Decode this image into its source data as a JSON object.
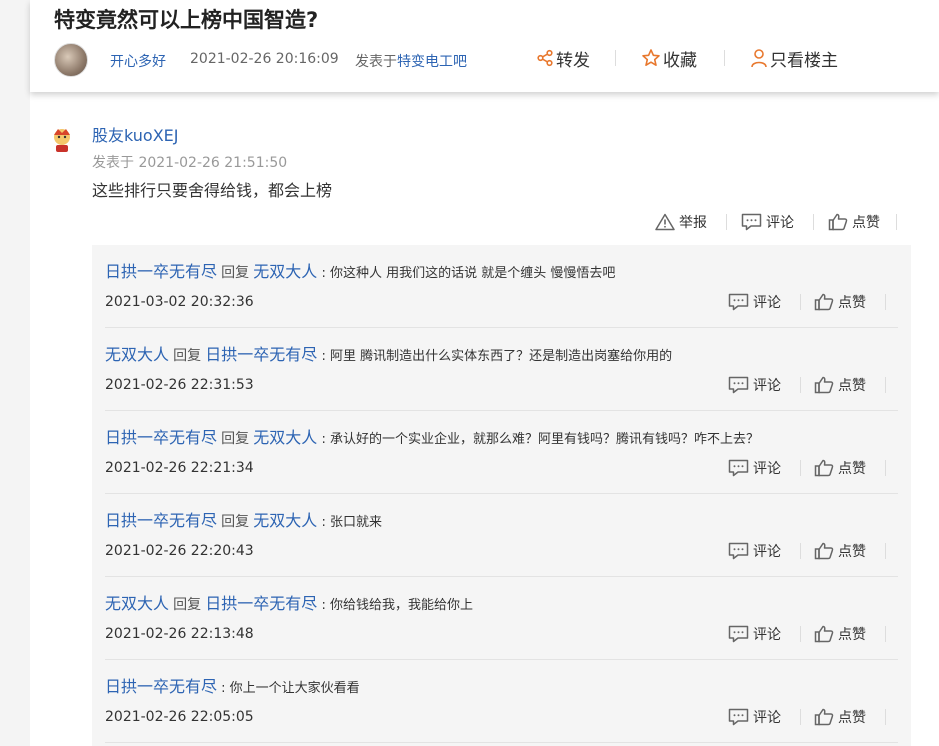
{
  "post": {
    "title": "特变竟然可以上榜中国智造?",
    "author": "开心多好",
    "time": "2021-02-26 20:16:09",
    "posted_in_label": "发表于",
    "forum": "特变电工吧",
    "actions": {
      "share": "转发",
      "favorite": "收藏",
      "only_op": "只看楼主"
    }
  },
  "floor": {
    "author": "股友kuoXEJ",
    "time": "发表于 2021-02-26 21:51:50",
    "text": "这些排行只要舍得给钱，都会上榜",
    "actions": {
      "report": "举报",
      "comment": "评论",
      "like": "点赞"
    }
  },
  "reply_actions": {
    "comment": "评论",
    "like": "点赞"
  },
  "replies": [
    {
      "user": "日拱一卒无有尽",
      "reply_word": "回复",
      "target": "无双大人",
      "text": "你这种人 用我们这的话说 就是个缠头 慢慢悟去吧",
      "time": "2021-03-02 20:32:36"
    },
    {
      "user": "无双大人",
      "reply_word": "回复",
      "target": "日拱一卒无有尽",
      "text": "阿里 腾讯制造出什么实体东西了？还是制造出岗塞给你用的",
      "time": "2021-02-26 22:31:53"
    },
    {
      "user": "日拱一卒无有尽",
      "reply_word": "回复",
      "target": "无双大人",
      "text": "承认好的一个实业企业，就那么难？阿里有钱吗？腾讯有钱吗？咋不上去？",
      "time": "2021-02-26 22:21:34"
    },
    {
      "user": "日拱一卒无有尽",
      "reply_word": "回复",
      "target": "无双大人",
      "text": "张口就来",
      "time": "2021-02-26 22:20:43"
    },
    {
      "user": "无双大人",
      "reply_word": "回复",
      "target": "日拱一卒无有尽",
      "text": "你给钱给我，我能给你上",
      "time": "2021-02-26 22:13:48"
    },
    {
      "user": "日拱一卒无有尽",
      "text": "你上一个让大家伙看看",
      "time": "2021-02-26 22:05:05"
    }
  ]
}
